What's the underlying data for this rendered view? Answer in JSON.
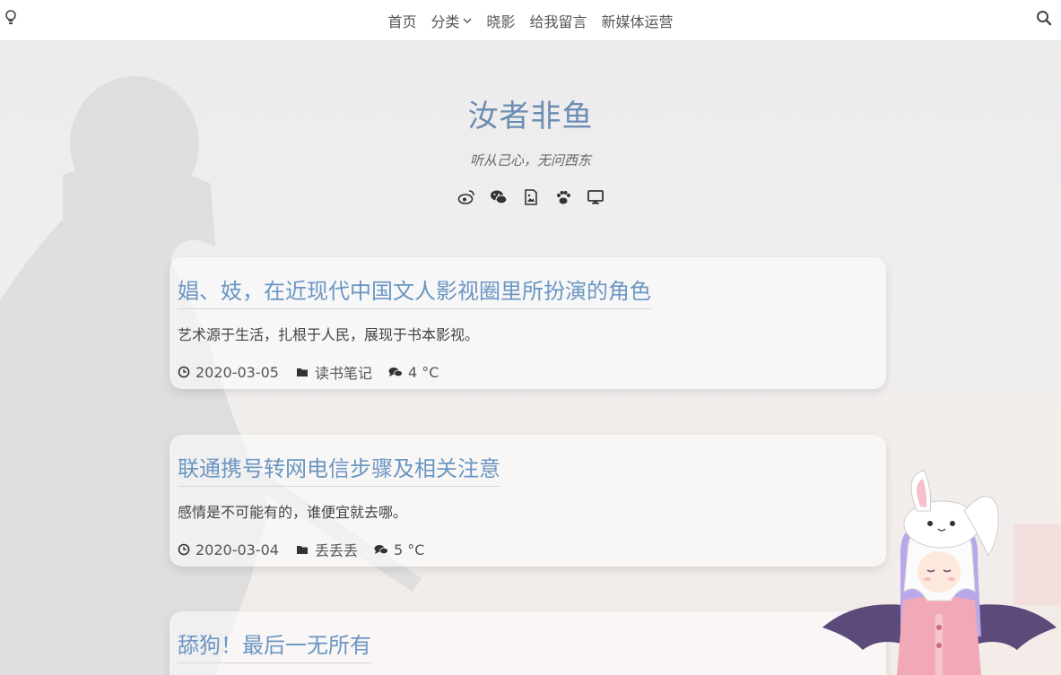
{
  "nav": {
    "items": [
      {
        "label": "首页"
      },
      {
        "label": "分类"
      },
      {
        "label": "晓影"
      },
      {
        "label": "给我留言"
      },
      {
        "label": "新媒体运营"
      }
    ]
  },
  "header": {
    "title": "汝者非鱼",
    "subtitle": "听从己心，无问西东",
    "social_icons": [
      "weibo-icon",
      "wechat-icon",
      "image-icon",
      "paw-icon",
      "desktop-icon"
    ]
  },
  "posts": [
    {
      "title": "娼、妓，在近现代中国文人影视圈里所扮演的角色",
      "excerpt": "艺术源于生活，扎根于人民，展现于书本影视。",
      "date": "2020-03-05",
      "category": "读书笔记",
      "comments": "4 °C"
    },
    {
      "title": "联通携号转网电信步骤及相关注意",
      "excerpt": "感情是不可能有的，谁便宜就去哪。",
      "date": "2020-03-04",
      "category": "丢丢丢",
      "comments": "5 °C"
    },
    {
      "title": "舔狗！最后一无所有"
    }
  ],
  "colors": {
    "title": "#6c8db3",
    "link": "#6a96c3"
  }
}
